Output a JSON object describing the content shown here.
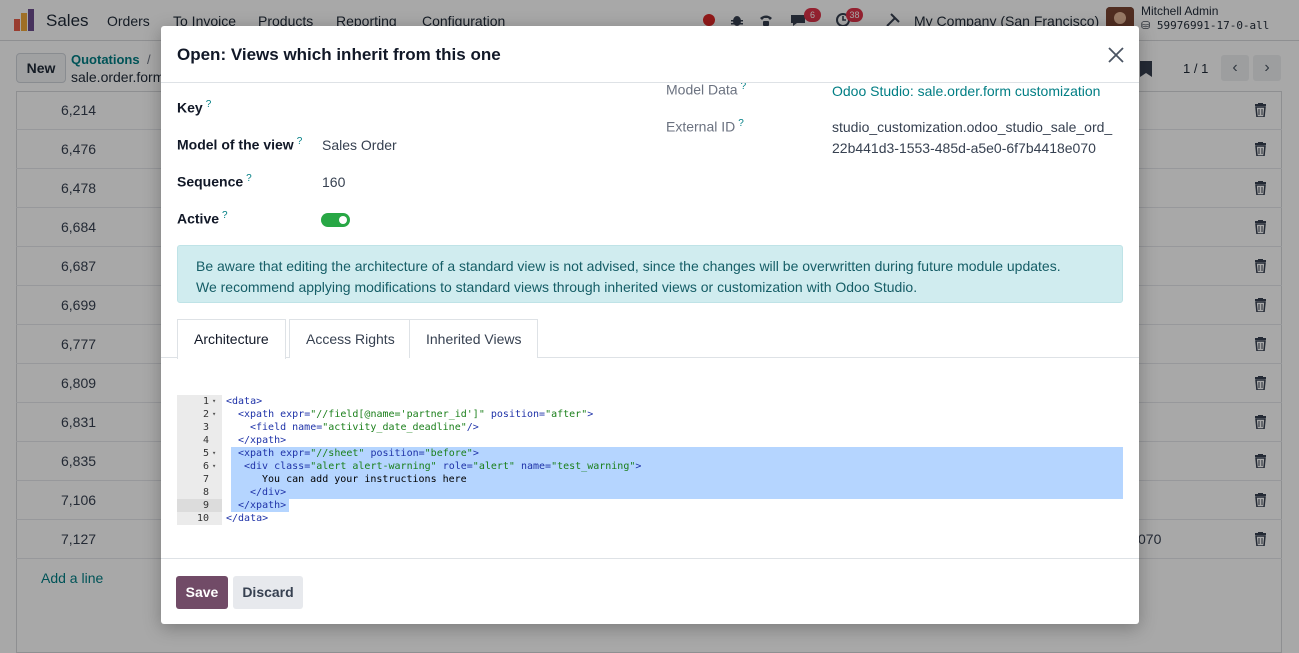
{
  "navbar": {
    "app_name": "Sales",
    "menu": [
      "Orders",
      "To Invoice",
      "Products",
      "Reporting",
      "Configuration"
    ],
    "chat_count": "6",
    "activity_count": "38",
    "company": "My Company (San Francisco)",
    "user_name": "Mitchell Admin",
    "database": "59976991-17-0-all"
  },
  "control_panel": {
    "new_label": "New",
    "breadcrumb_parent": "Quotations",
    "breadcrumb_sep": "/",
    "breadcrumb_current": "sale.order.form",
    "pager": "1 / 1"
  },
  "background_rows": [
    {
      "value": "6,214",
      "tail": ""
    },
    {
      "value": "6,476",
      "tail": ""
    },
    {
      "value": "6,478",
      "tail": ""
    },
    {
      "value": "6,684",
      "tail": ""
    },
    {
      "value": "6,687",
      "tail": ""
    },
    {
      "value": "6,699",
      "tail": ""
    },
    {
      "value": "6,777",
      "tail": ""
    },
    {
      "value": "6,809",
      "tail": ""
    },
    {
      "value": "6,831",
      "tail": ""
    },
    {
      "value": "6,835",
      "tail": ""
    },
    {
      "value": "7,106",
      "tail": ""
    },
    {
      "value": "7,127",
      "tail": "070"
    }
  ],
  "add_line": "Add a line",
  "modal": {
    "title": "Open: Views which inherit from this one",
    "fields": {
      "key_label": "Key",
      "model_label": "Model of the view",
      "model_value": "Sales Order",
      "sequence_label": "Sequence",
      "sequence_value": "160",
      "active_label": "Active",
      "active_value": true,
      "model_data_label": "Model Data",
      "model_data_value": "Odoo Studio: sale.order.form customization",
      "external_id_label": "External ID",
      "external_id_line1": "studio_customization.odoo_studio_sale_ord_",
      "external_id_line2": "22b441d3-1553-485d-a5e0-6f7b4418e070",
      "help_mark": "?"
    },
    "alert_line1": "Be aware that editing the architecture of a standard view is not advised, since the changes will be overwritten during future module updates.",
    "alert_line2": "We recommend applying modifications to standard views through inherited views or customization with Odoo Studio.",
    "tabs": [
      "Architecture",
      "Access Rights",
      "Inherited Views"
    ],
    "code_lines": [
      {
        "n": "1",
        "fold": "▾"
      },
      {
        "n": "2",
        "fold": "▾"
      },
      {
        "n": "3",
        "fold": ""
      },
      {
        "n": "4",
        "fold": ""
      },
      {
        "n": "5",
        "fold": "▾"
      },
      {
        "n": "6",
        "fold": "▾"
      },
      {
        "n": "7",
        "fold": ""
      },
      {
        "n": "8",
        "fold": ""
      },
      {
        "n": "9",
        "fold": ""
      },
      {
        "n": "10",
        "fold": ""
      }
    ],
    "code": {
      "l1_tag": "<data>",
      "l2_a": "<xpath expr=",
      "l2_b": "\"//field[@name='partner_id']\"",
      "l2_c": " position=",
      "l2_d": "\"after\"",
      "l2_e": ">",
      "l3_a": "<field name=",
      "l3_b": "\"activity_date_deadline\"",
      "l3_c": "/>",
      "l4": "</xpath>",
      "l5_a": "<xpath expr=",
      "l5_b": "\"//sheet\"",
      "l5_c": " position=",
      "l5_d": "\"before\"",
      "l5_e": ">",
      "l6_a": "<div class=",
      "l6_b": "\"alert alert-warning\"",
      "l6_c": " role=",
      "l6_d": "\"alert\"",
      "l6_e": " name=",
      "l6_f": "\"test_warning\"",
      "l6_g": ">",
      "l7": "You can add your instructions here",
      "l8": "</div>",
      "l9": "</xpath>",
      "l10": "</data>"
    },
    "save_label": "Save",
    "discard_label": "Discard"
  }
}
